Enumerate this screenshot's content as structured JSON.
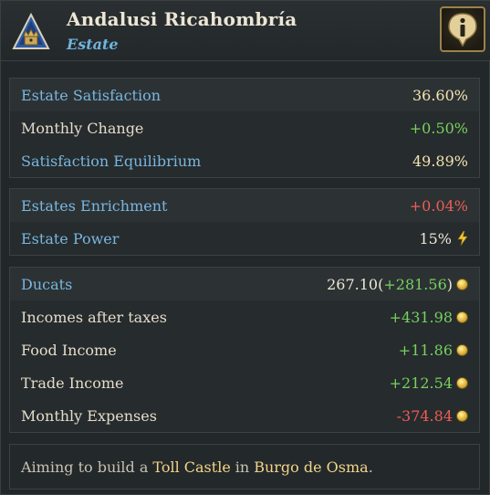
{
  "header": {
    "title": "Andalusi Ricahombría",
    "subtitle": "Estate",
    "icon": "estate-crown-icon",
    "info_icon": "info-icon"
  },
  "satisfaction": {
    "rows": [
      {
        "label": "Estate Satisfaction",
        "value": "36.60%"
      },
      {
        "label": "Monthly Change",
        "value": "+0.50%"
      },
      {
        "label": "Satisfaction Equilibrium",
        "value": "49.89%"
      }
    ]
  },
  "power": {
    "rows": [
      {
        "label": "Estates Enrichment",
        "value": "+0.04%"
      },
      {
        "label": "Estate Power",
        "value": "15%"
      }
    ]
  },
  "finances": {
    "ducats": {
      "label": "Ducats",
      "value": "267.10",
      "change_open": "(",
      "change": "+281.56",
      "change_close": ")"
    },
    "rows": [
      {
        "label": "Incomes after taxes",
        "value": "+431.98"
      },
      {
        "label": "Food Income",
        "value": "+11.86"
      },
      {
        "label": "Trade Income",
        "value": "+212.54"
      },
      {
        "label": "Monthly Expenses",
        "value": "-374.84"
      }
    ]
  },
  "footer": {
    "prefix": "Aiming to build a",
    "building": "Toll Castle",
    "middle": "in",
    "location": "Burgo de Osma",
    "suffix": "."
  },
  "colors": {
    "positive": "#77d15f",
    "negative": "#ec5d55",
    "highlight": "#f4e3b0",
    "label_blue": "#79b6df",
    "gold": "#e7bf45"
  }
}
